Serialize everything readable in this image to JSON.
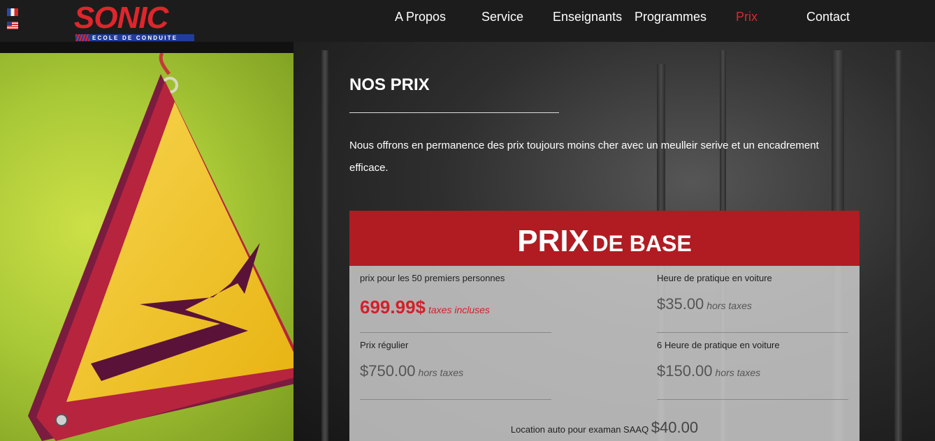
{
  "header": {
    "logo_text": "SONIC",
    "logo_subtitle": "ECOLE DE CONDUITE",
    "nav": [
      {
        "label": "A Propos",
        "active": false
      },
      {
        "label": "Service",
        "active": false
      },
      {
        "label": "Enseignants",
        "active": false
      },
      {
        "label": "Programmes",
        "active": false
      },
      {
        "label": "Prix",
        "active": true
      },
      {
        "label": "Contact",
        "active": false
      }
    ]
  },
  "colors": {
    "accent": "#d42b2b",
    "header_bg": "#1c1c1c",
    "price_band": "#b01c22"
  },
  "icons": [
    "french-flag-icon",
    "us-flag-icon",
    "warning-sign-image"
  ],
  "section": {
    "title": "NOS PRIX",
    "intro": "Nous offrons en permanence des prix toujours moins cher avec un meulleir serive et un encadrement efficace."
  },
  "pricing": {
    "heading_big": "PRIX",
    "heading_small": "DE BASE",
    "items": [
      {
        "label": "prix pour les 50 premiers personnes",
        "price": "699.99$",
        "note": "taxes incluses",
        "highlight": true
      },
      {
        "label": "Heure de pratique en voiture",
        "price": "$35.00",
        "note": "hors taxes",
        "highlight": false
      },
      {
        "label": "Prix régulier",
        "price": "$750.00",
        "note": "hors taxes",
        "highlight": false
      },
      {
        "label": "6 Heure de pratique en voiture",
        "price": "$150.00",
        "note": "hors taxes",
        "highlight": false
      }
    ],
    "rental_label": "Location auto pour examan SAAQ",
    "rental_price": "$40.00"
  }
}
